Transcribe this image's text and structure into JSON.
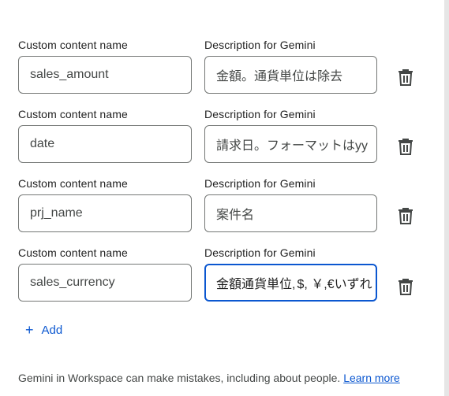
{
  "rows": [
    {
      "name_label": "Custom content name",
      "desc_label": "Description for Gemini",
      "name_value": "sales_amount",
      "desc_value": "金額。通貨単位は除去"
    },
    {
      "name_label": "Custom content name",
      "desc_label": "Description for Gemini",
      "name_value": "date",
      "desc_value": "請求日。フォーマットはyy"
    },
    {
      "name_label": "Custom content name",
      "desc_label": "Description for Gemini",
      "name_value": "prj_name",
      "desc_value": "案件名"
    },
    {
      "name_label": "Custom content name",
      "desc_label": "Description for Gemini",
      "name_value": "sales_currency",
      "desc_value_before_caret": "金額通貨単位, ",
      "desc_value_after_caret": "$, ￥,€いずれ"
    }
  ],
  "add_label": "Add",
  "footer": {
    "text": "Gemini in Workspace can make mistakes, including about people. ",
    "link": "Learn more"
  },
  "colors": {
    "accent": "#0b57d0",
    "border": "#747775",
    "text": "#1f1f1f",
    "muted": "#444746"
  }
}
